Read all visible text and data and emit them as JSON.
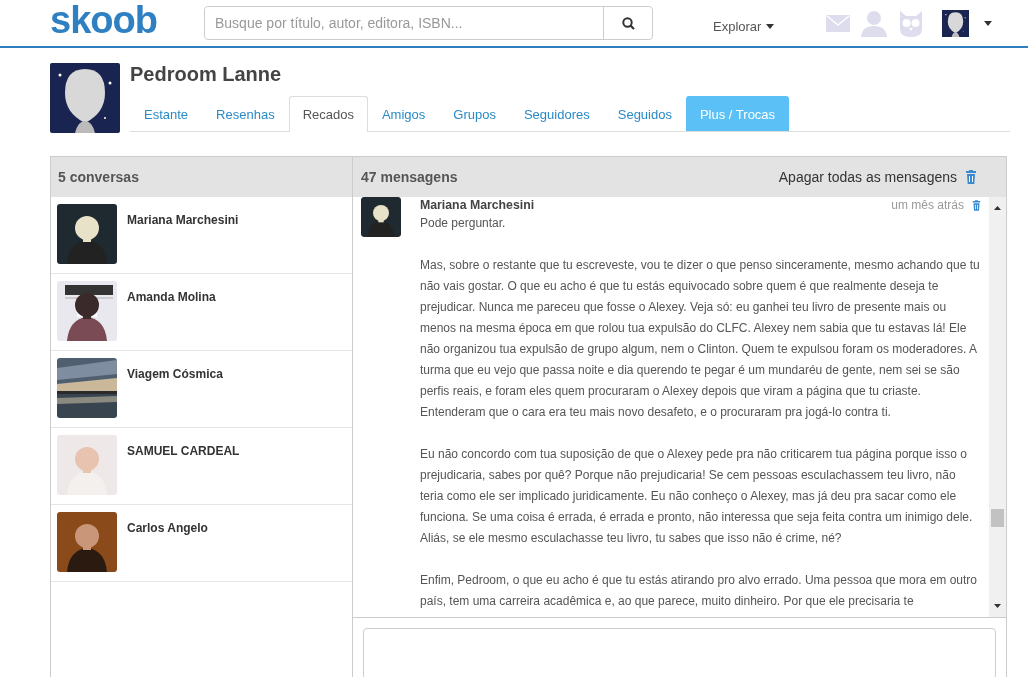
{
  "header": {
    "logo": "skoob",
    "search": {
      "placeholder": "Busque por título, autor, editora, ISBN..."
    },
    "explore": "Explorar"
  },
  "profile": {
    "name": "Pedroom Lanne",
    "tabs": [
      {
        "label": "Estante",
        "selected": false,
        "kind": "tab"
      },
      {
        "label": "Resenhas",
        "selected": false,
        "kind": "tab"
      },
      {
        "label": "Recados",
        "selected": true,
        "kind": "tab"
      },
      {
        "label": "Amigos",
        "selected": false,
        "kind": "tab"
      },
      {
        "label": "Grupos",
        "selected": false,
        "kind": "tab"
      },
      {
        "label": "Seguidores",
        "selected": false,
        "kind": "tab"
      },
      {
        "label": "Seguidos",
        "selected": false,
        "kind": "tab"
      },
      {
        "label": "Plus / Trocas",
        "selected": false,
        "kind": "highlight"
      }
    ]
  },
  "conversations": {
    "title": "5 conversas",
    "items": [
      {
        "name": "Mariana Marchesini"
      },
      {
        "name": "Amanda Molina"
      },
      {
        "name": "Viagem Cósmica"
      },
      {
        "name": "SAMUEL CARDEAL"
      },
      {
        "name": "Carlos Angelo"
      }
    ]
  },
  "messages": {
    "title": "47 mensagens",
    "delete_all": "Apagar todas as mensagens",
    "items": [
      {
        "sender": "Mariana Marchesini",
        "time": "um mês atrás",
        "paragraphs": [
          "Pode perguntar.",
          "Mas, sobre o restante que tu escreveste, vou te dizer o que penso sinceramente, mesmo achando que tu não vais gostar. O que eu acho é que tu estás equivocado sobre quem é que realmente deseja te prejudicar. Nunca me pareceu que fosse o Alexey. Veja só: eu ganhei teu livro de presente mais ou menos na mesma época em que rolou tua expulsão do CLFC. Alexey nem sabia que tu estavas lá! Ele não organizou tua expulsão de grupo algum, nem o Clinton. Quem te expulsou foram os moderadores. A turma que eu vejo que passa noite e dia querendo te pegar é um mundaréu de gente, nem sei se são perfis reais, e foram eles quem procuraram o Alexey depois que viram a página que tu criaste. Entenderam que o cara era teu mais novo desafeto, e o procuraram pra jogá-lo contra ti.",
          "Eu não concordo com tua suposição de que o Alexey pede pra não criticarem tua página porque isso o prejudicaria, sabes por quê? Porque não prejudicaria! Se cem pessoas esculachassem teu livro, não teria como ele ser implicado juridicamente. Eu não conheço o Alexey, mas já deu pra sacar como ele funciona. Se uma coisa é errada, é errada e pronto, não interessa que seja feita contra um inimigo dele. Aliás, se ele mesmo esculachasse teu livro, tu sabes que isso não é crime, né?",
          "Enfim, Pedroom, o que eu acho é que tu estás atirando pro alvo errado. Uma pessoa que mora em outro país, tem uma carreira acadêmica e, ao que parece, muito dinheiro. Por que ele precisaria te"
        ]
      }
    ]
  }
}
